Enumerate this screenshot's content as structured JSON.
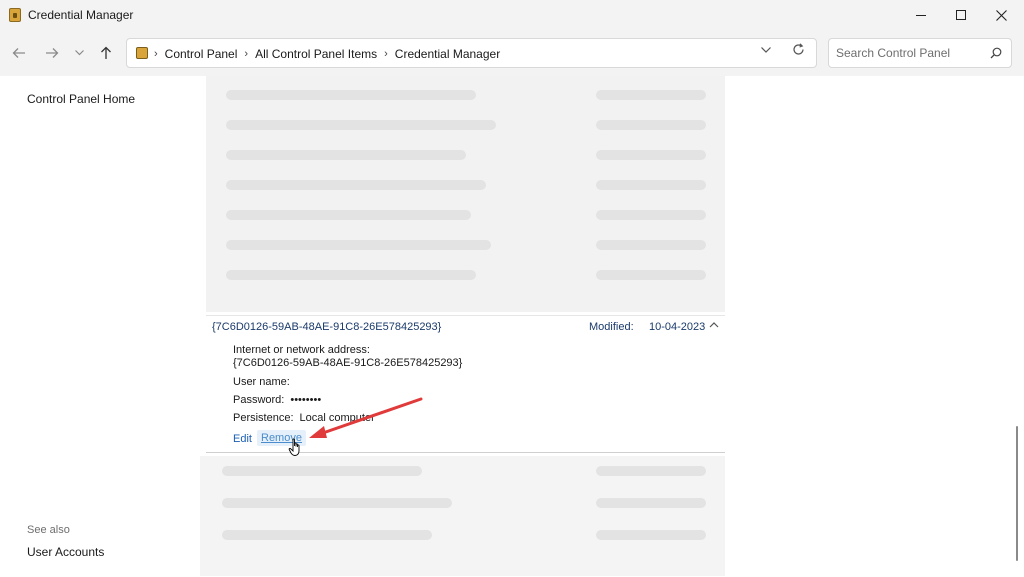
{
  "window": {
    "title": "Credential Manager",
    "icons": {
      "app": "credential-manager-icon",
      "minimize": "minimize-icon",
      "maximize": "maximize-icon",
      "close": "close-icon"
    }
  },
  "nav": {
    "icons": [
      "back-arrow-icon",
      "forward-arrow-icon",
      "recent-locations-chevron-icon",
      "up-arrow-icon"
    ]
  },
  "address": {
    "crumbs": [
      "Control Panel",
      "All Control Panel Items",
      "Credential Manager"
    ],
    "icons": {
      "location": "control-panel-icon",
      "dropdown": "chevron-down-icon",
      "refresh": "refresh-icon"
    }
  },
  "search": {
    "placeholder": "Search Control Panel",
    "value": "",
    "icon": "search-icon"
  },
  "sidebar": {
    "home": "Control Panel Home",
    "see_also": "See also",
    "links": [
      "User Accounts"
    ]
  },
  "credential": {
    "name": "{7C6D0126-59AB-48AE-91C8-26E578425293}",
    "modified_label": "Modified:",
    "modified_date": "10-04-2023",
    "address_label": "Internet or network address:",
    "address_value": "{7C6D0126-59AB-48AE-91C8-26E578425293}",
    "username_label": "User name:",
    "username_value": "",
    "password_label": "Password:",
    "password_value": "••••••••",
    "persistence_label": "Persistence:",
    "persistence_value": "Local computer",
    "edit_label": "Edit",
    "remove_label": "Remove",
    "expand_icon": "chevron-up-icon"
  },
  "colors": {
    "chrome": "#f3f3f3",
    "link": "#1a5fb4",
    "remove_link": "#4a8ccc",
    "remove_highlight": "#e6f0fa",
    "annotation_arrow": "#e03a3a",
    "header_text": "#1a3a6b"
  },
  "annotation": {
    "icons": [
      "red-arrow-icon",
      "hand-cursor-icon"
    ]
  }
}
